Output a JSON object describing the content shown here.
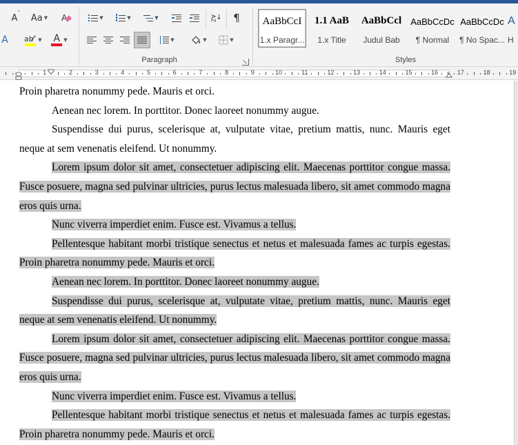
{
  "ribbon": {
    "font_group": {
      "shrink_font_label": "A",
      "change_case_label": "Aa",
      "text_effects_label": "A",
      "font_color_label": "A",
      "font_color": "#e81123",
      "highlight_color": "#ffff00"
    },
    "paragraph_group": {
      "label": "Paragraph",
      "pilcrow_label": "¶",
      "sort_label": "AZ"
    },
    "styles_group": {
      "label": "Styles",
      "items": [
        {
          "preview": "AaBbCcI",
          "name": "1.x Paragr..."
        },
        {
          "preview": "1.1  AaB",
          "name": "1.x Title"
        },
        {
          "preview": "AaBbCcl",
          "name": "Judul Bab"
        },
        {
          "preview": "AaBbCcDc",
          "name": "¶ Normal"
        },
        {
          "preview": "AaBbCcDc",
          "name": "¶ No Spac..."
        },
        {
          "preview": "A",
          "name": "H"
        }
      ]
    }
  },
  "ruler": {
    "numbers": [
      "1",
      "1",
      "2",
      "3",
      "4",
      "5",
      "6",
      "7",
      "8",
      "9",
      "10",
      "11",
      "12",
      "13",
      "14",
      "15",
      "16",
      "17",
      "18",
      "19"
    ]
  },
  "document": {
    "paragraphs": [
      {
        "text": "Proin pharetra nonummy pede. Mauris et orci.",
        "selected": false,
        "indent": false
      },
      {
        "text": "Aenean nec lorem. In porttitor. Donec laoreet nonummy augue.",
        "selected": false,
        "indent": true
      },
      {
        "text": "Suspendisse dui purus, scelerisque at, vulputate vitae, pretium mattis, nunc. Mauris eget neque at sem venenatis eleifend. Ut nonummy.",
        "selected": false,
        "indent": true
      },
      {
        "text": "Lorem ipsum dolor sit amet, consectetuer adipiscing elit. Maecenas porttitor congue massa. Fusce posuere, magna sed pulvinar ultricies, purus lectus malesuada libero, sit amet commodo magna eros quis urna.",
        "selected": true,
        "indent": true
      },
      {
        "text": "Nunc viverra imperdiet enim. Fusce est. Vivamus a tellus.",
        "selected": true,
        "indent": true
      },
      {
        "text": "Pellentesque habitant morbi tristique senectus et netus et malesuada fames ac turpis egestas. Proin pharetra nonummy pede. Mauris et orci.",
        "selected": true,
        "indent": true
      },
      {
        "text": "Aenean nec lorem. In porttitor. Donec laoreet nonummy augue.",
        "selected": true,
        "indent": true
      },
      {
        "text": "Suspendisse dui purus, scelerisque at, vulputate vitae, pretium mattis, nunc. Mauris eget neque at sem venenatis eleifend. Ut nonummy.",
        "selected": true,
        "indent": true
      },
      {
        "text": "Lorem ipsum dolor sit amet, consectetuer adipiscing elit. Maecenas porttitor congue massa. Fusce posuere, magna sed pulvinar ultricies, purus lectus malesuada libero, sit amet commodo magna eros quis urna.",
        "selected": true,
        "indent": true
      },
      {
        "text": "Nunc viverra imperdiet enim. Fusce est. Vivamus a tellus.",
        "selected": true,
        "indent": true
      },
      {
        "text": "Pellentesque habitant morbi tristique senectus et netus et malesuada fames ac turpis egestas. Proin pharetra nonummy pede. Mauris et orci.",
        "selected": true,
        "indent": true
      }
    ]
  }
}
